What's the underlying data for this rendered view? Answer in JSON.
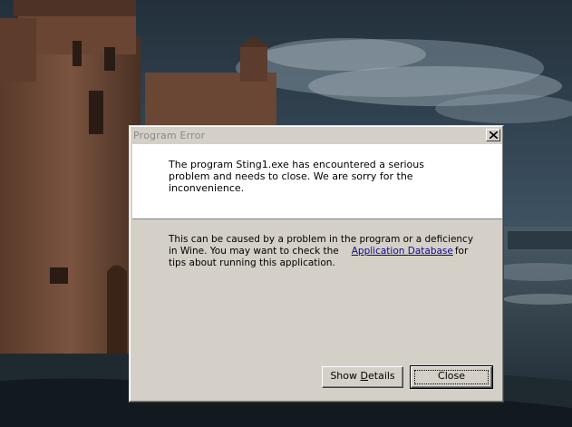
{
  "dialog": {
    "title": "Program Error",
    "close_icon": "close-icon",
    "message": "The program Sting1.exe has encountered a serious problem and needs to close. We are sorry for the inconvenience.",
    "info_before_link": "This can be caused by a problem in the program or a deficiency in Wine. You may want to check the",
    "link_text": "Application Database",
    "info_after_link": "for tips about running this application.",
    "details_label_pre": "Show ",
    "details_label_mnemonic": "D",
    "details_label_post": "etails",
    "close_label": "Close"
  },
  "colors": {
    "dialog_face": "#d4d0c8",
    "link": "#0a0a8c",
    "title_text": "#8a8a8a"
  }
}
